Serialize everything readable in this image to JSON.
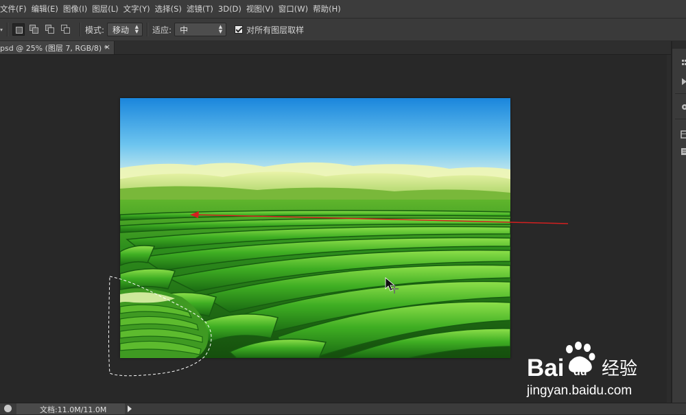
{
  "menu": [
    "文件(F)",
    "编辑(E)",
    "图像(I)",
    "图层(L)",
    "文字(Y)",
    "选择(S)",
    "滤镜(T)",
    "3D(D)",
    "视图(V)",
    "窗口(W)",
    "帮助(H)"
  ],
  "options": {
    "mode_label": "模式:",
    "mode_value": "移动",
    "adapt_label": "适应:",
    "adapt_value": "中",
    "sample_all_layers_label": "对所有图层取样",
    "sample_all_layers_checked": true
  },
  "document_tab": {
    "title": "psd @ 25% (图层 7, RGB/8) *",
    "close_glyph": "×"
  },
  "status": {
    "doc_size": "文档:11.0M/11.0M"
  },
  "watermark": {
    "brand": "Bai",
    "brand_tail": "du",
    "product": "经验",
    "url": "jingyan.baidu.com"
  },
  "colors": {
    "annotation_arrow": "#d42020",
    "sky_top": "#1c8fe0",
    "field_green": "#2f9e1e"
  },
  "icons": {
    "move_cursor": "move-cursor-icon",
    "paw": "baidu-paw-icon"
  }
}
